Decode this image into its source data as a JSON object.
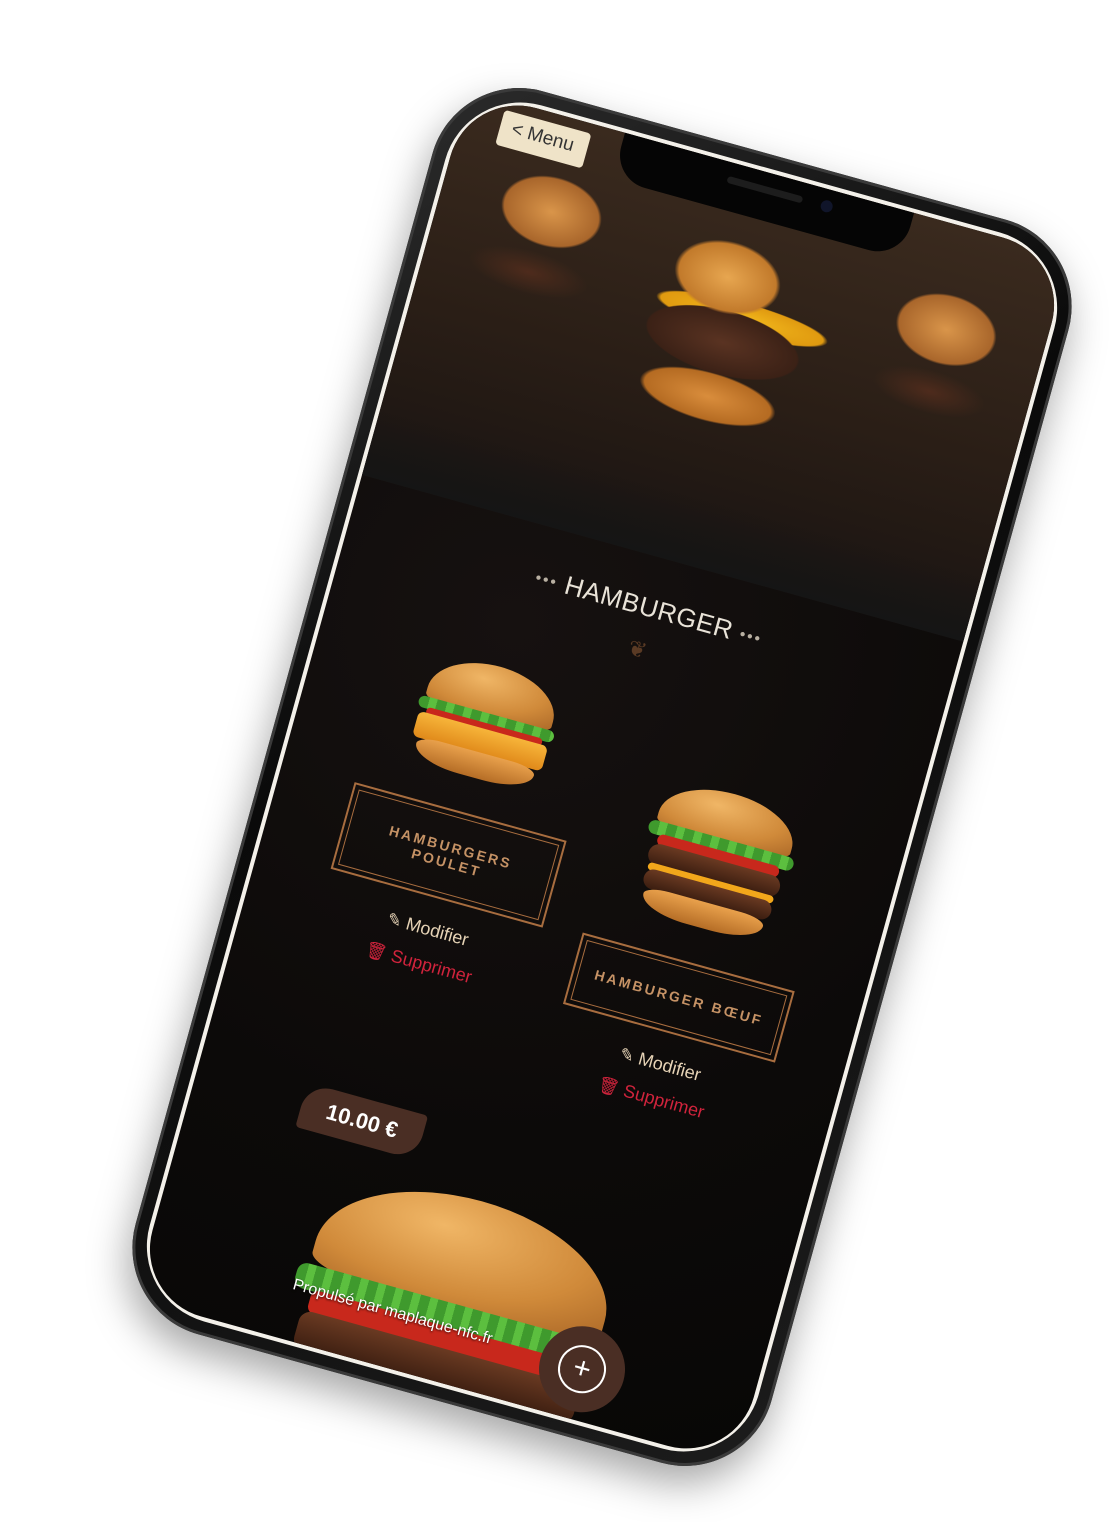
{
  "header": {
    "back_label": "< Menu"
  },
  "section": {
    "title": "HAMBURGER",
    "dots_left": "•••",
    "dots_right": "•••",
    "ornament": "❦"
  },
  "items": [
    {
      "name": "Hamburgers poulet",
      "edit_label": "Modifier",
      "delete_label": "Supprimer"
    },
    {
      "name": "Hamburger bœuf",
      "edit_label": "Modifier",
      "delete_label": "Supprimer"
    }
  ],
  "featured": {
    "price": "10.00 €"
  },
  "footer": {
    "powered_by": "Propulsé par maplaque-nfc.fr"
  },
  "fab": {
    "icon": "plus-circle-icon",
    "glyph": "+"
  },
  "icons": {
    "edit": "✎",
    "delete": "🗑"
  },
  "colors": {
    "accent_brown": "#4a2e24",
    "gold": "#c59265",
    "delete_red": "#d0233c",
    "menu_bg": "#efe3c8"
  }
}
